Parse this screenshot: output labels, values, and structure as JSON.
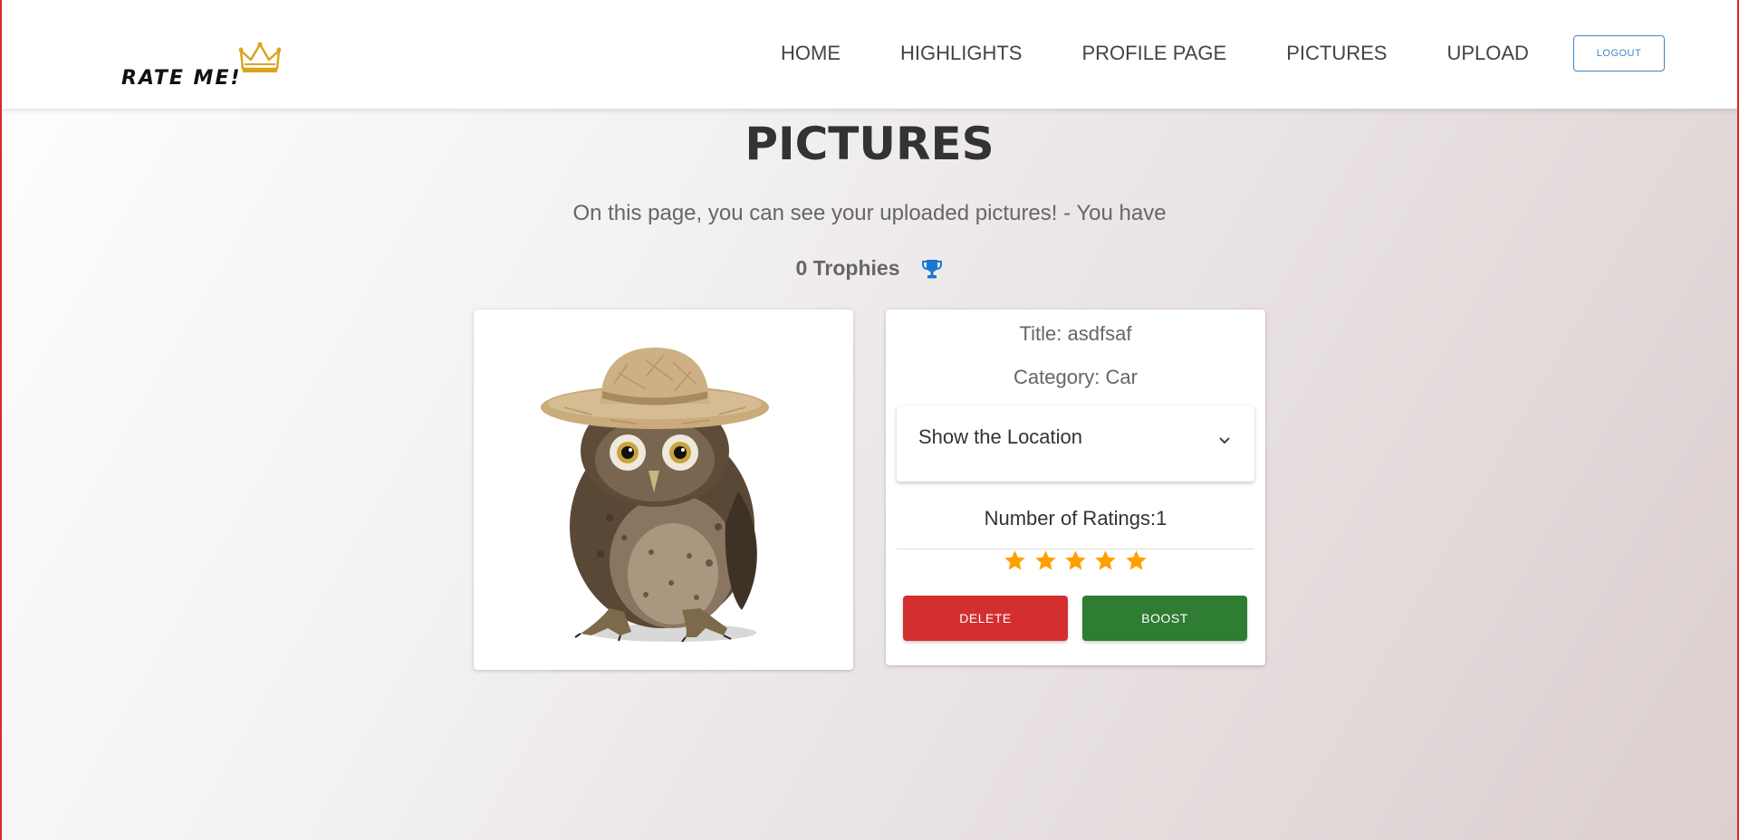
{
  "brand": {
    "name": "RATE ME!",
    "crown_color": "#d9a520"
  },
  "nav": {
    "links": [
      "HOME",
      "HIGHLIGHTS",
      "PROFILE PAGE",
      "PICTURES",
      "UPLOAD"
    ],
    "logout_label": "LOGOUT"
  },
  "header": {
    "title": "PICTURES",
    "subtitle": "On this page, you can see your uploaded pictures! - You have",
    "trophies": "0 Trophies"
  },
  "picture": {
    "image_icon": "owl-with-straw-hat-image",
    "title": "Title: asdfsaf",
    "category": "Category: Car",
    "location_toggle": "Show the Location",
    "ratings": "Number of Ratings:1",
    "stars": 5,
    "delete_label": "DELETE",
    "boost_label": "BOOST"
  },
  "colors": {
    "accent_blue": "#1976d2",
    "star": "#ffa000",
    "delete": "#d32f2f",
    "boost": "#2e7d32",
    "frame": "#e0242a"
  }
}
